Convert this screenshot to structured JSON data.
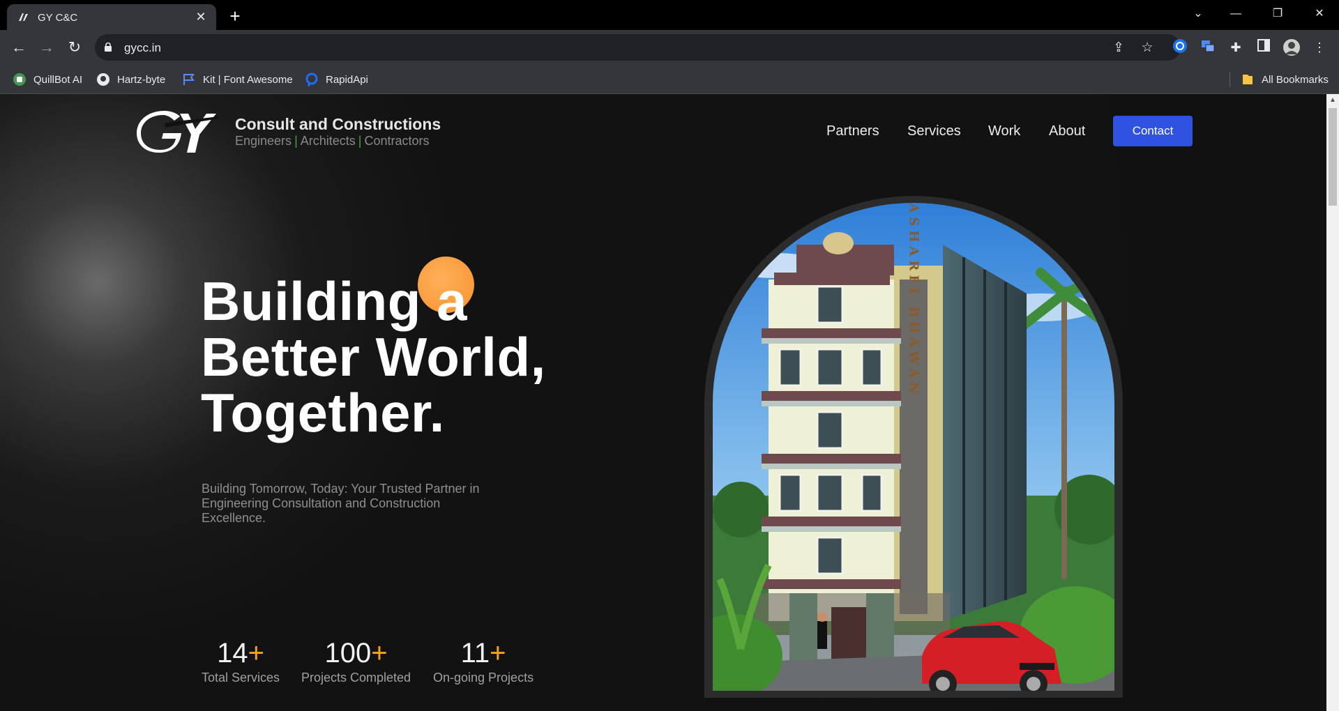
{
  "browser": {
    "tab_title": "GY C&C",
    "tab_close": "✕",
    "new_tab": "+",
    "url": "gycc.in",
    "window_controls": {
      "chevron": "⌄",
      "minimize": "—",
      "restore": "❐",
      "close": "✕"
    },
    "bookmarks": [
      {
        "label": "QuillBot AI",
        "icon": "quillbot-icon"
      },
      {
        "label": "Hartz-byte",
        "icon": "github-icon"
      },
      {
        "label": "Kit | Font Awesome",
        "icon": "flag-icon"
      },
      {
        "label": "RapidApi",
        "icon": "rapidapi-icon"
      }
    ],
    "all_bookmarks": "All Bookmarks"
  },
  "header": {
    "brand_title": "Consult and Constructions",
    "brand_sub": [
      "Engineers",
      "Architects",
      "Contractors"
    ],
    "brand_sep": "|",
    "nav": [
      "Partners",
      "Services",
      "Work",
      "About"
    ],
    "contact": "Contact"
  },
  "hero": {
    "lines": [
      "Building a",
      "Better World,",
      "Together."
    ],
    "tagline": "Building Tomorrow, Today: Your Trusted Partner in Engineering Consultation and Construction Excellence."
  },
  "stats": [
    {
      "value": "14",
      "plus": "+",
      "label": "Total Services"
    },
    {
      "value": "100",
      "plus": "+",
      "label": "Projects Completed"
    },
    {
      "value": "11",
      "plus": "+",
      "label": "On-going Projects"
    }
  ],
  "building_sign": "ASHARFI BHAWAN",
  "colors": {
    "accent_blue": "#2f52e0",
    "accent_orange": "#f7a21e",
    "separator_green": "#3fa34d"
  }
}
